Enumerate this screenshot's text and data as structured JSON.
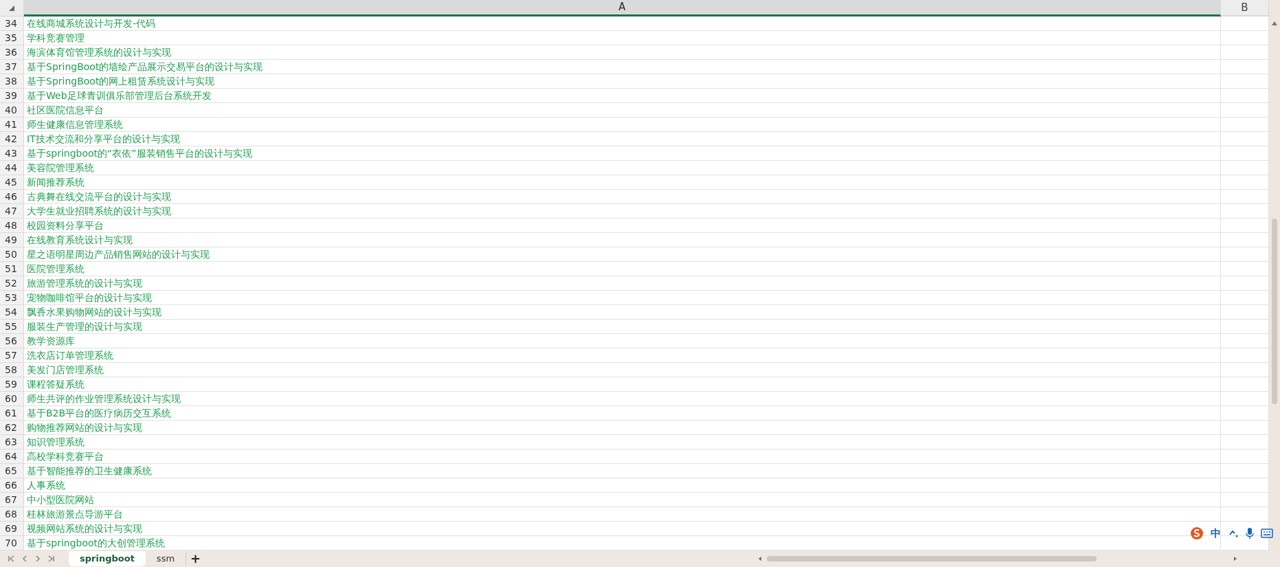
{
  "columns": [
    {
      "label": "A",
      "selected": true
    },
    {
      "label": "B",
      "selected": false
    }
  ],
  "rows": [
    {
      "number": "34",
      "cells": [
        "在线商城系统设计与开发-代码"
      ]
    },
    {
      "number": "35",
      "cells": [
        "学科竞赛管理"
      ]
    },
    {
      "number": "36",
      "cells": [
        "海滨体育馆管理系统的设计与实现"
      ]
    },
    {
      "number": "37",
      "cells": [
        "基于SpringBoot的墙绘产品展示交易平台的设计与实现"
      ]
    },
    {
      "number": "38",
      "cells": [
        "基于SpringBoot的网上租赁系统设计与实现"
      ]
    },
    {
      "number": "39",
      "cells": [
        "基于Web足球青训俱乐部管理后台系统开发"
      ]
    },
    {
      "number": "40",
      "cells": [
        "社区医院信息平台"
      ]
    },
    {
      "number": "41",
      "cells": [
        "师生健康信息管理系统"
      ]
    },
    {
      "number": "42",
      "cells": [
        "IT技术交流和分享平台的设计与实现"
      ]
    },
    {
      "number": "43",
      "cells": [
        "基于springboot的“衣依”服装销售平台的设计与实现"
      ]
    },
    {
      "number": "44",
      "cells": [
        "美容院管理系统"
      ]
    },
    {
      "number": "45",
      "cells": [
        "新闻推荐系统"
      ]
    },
    {
      "number": "46",
      "cells": [
        "古典舞在线交流平台的设计与实现"
      ]
    },
    {
      "number": "47",
      "cells": [
        "大学生就业招聘系统的设计与实现"
      ]
    },
    {
      "number": "48",
      "cells": [
        "校园资料分享平台"
      ]
    },
    {
      "number": "49",
      "cells": [
        "在线教育系统设计与实现"
      ]
    },
    {
      "number": "50",
      "cells": [
        "星之语明星周边产品销售网站的设计与实现"
      ]
    },
    {
      "number": "51",
      "cells": [
        "医院管理系统"
      ]
    },
    {
      "number": "52",
      "cells": [
        "旅游管理系统的设计与实现"
      ]
    },
    {
      "number": "53",
      "cells": [
        "宠物咖啡馆平台的设计与实现"
      ]
    },
    {
      "number": "54",
      "cells": [
        "飘香水果购物网站的设计与实现"
      ]
    },
    {
      "number": "55",
      "cells": [
        "服装生产管理的设计与实现"
      ]
    },
    {
      "number": "56",
      "cells": [
        "教学资源库"
      ]
    },
    {
      "number": "57",
      "cells": [
        "洗衣店订单管理系统"
      ]
    },
    {
      "number": "58",
      "cells": [
        "美发门店管理系统"
      ]
    },
    {
      "number": "59",
      "cells": [
        "课程答疑系统"
      ]
    },
    {
      "number": "60",
      "cells": [
        "师生共评的作业管理系统设计与实现"
      ]
    },
    {
      "number": "61",
      "cells": [
        "基于B2B平台的医疗病历交互系统"
      ]
    },
    {
      "number": "62",
      "cells": [
        "购物推荐网站的设计与实现"
      ]
    },
    {
      "number": "63",
      "cells": [
        "知识管理系统"
      ]
    },
    {
      "number": "64",
      "cells": [
        "高校学科竞赛平台"
      ]
    },
    {
      "number": "65",
      "cells": [
        "基于智能推荐的卫生健康系统"
      ]
    },
    {
      "number": "66",
      "cells": [
        "人事系统"
      ]
    },
    {
      "number": "67",
      "cells": [
        "中小型医院网站"
      ]
    },
    {
      "number": "68",
      "cells": [
        "桂林旅游景点导游平台"
      ]
    },
    {
      "number": "69",
      "cells": [
        "视频网站系统的设计与实现"
      ]
    },
    {
      "number": "70",
      "cells": [
        "基于springboot的大创管理系统"
      ]
    }
  ],
  "sheet_tabs": [
    {
      "label": "springboot",
      "selected": true
    },
    {
      "label": "ssm",
      "selected": false
    }
  ],
  "add_sheet": "+",
  "ime_toolbar": {
    "mode": "中"
  }
}
